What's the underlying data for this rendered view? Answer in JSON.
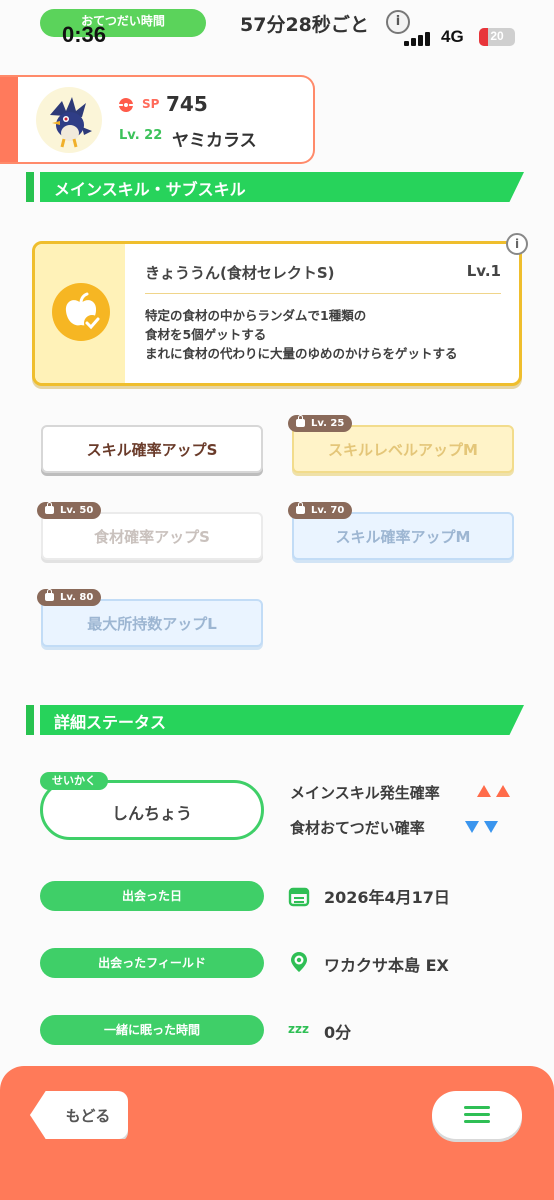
{
  "status_bar": {
    "help_label": "おてつだい時間",
    "time": "0:36",
    "interval": "57分28秒ごと",
    "network": "4G",
    "battery": "20"
  },
  "pokemon": {
    "sp_label": "SP",
    "sp_value": "745",
    "level": "Lv. 22",
    "name": "ヤミカラス"
  },
  "skills_section": {
    "title": "メインスキル・サブスキル",
    "main_skill": {
      "name": "きょううん(食材セレクトS)",
      "level": "Lv.1",
      "desc_line1": "特定の食材の中からランダムで1種類の",
      "desc_line2": "食材を5個ゲットする",
      "desc_line3": "まれに食材の代わりに大量のゆめのかけらをゲットする"
    },
    "subskills": [
      {
        "label": "スキル確率アップS",
        "lock": ""
      },
      {
        "label": "スキルレベルアップM",
        "lock": "Lv. 25"
      },
      {
        "label": "食材確率アップS",
        "lock": "Lv. 50"
      },
      {
        "label": "スキル確率アップM",
        "lock": "Lv. 70"
      },
      {
        "label": "最大所持数アップL",
        "lock": "Lv. 80"
      }
    ]
  },
  "detail_section": {
    "title": "詳細ステータス",
    "nature_tag": "せいかく",
    "nature": "しんちょう",
    "up_effect": "メインスキル発生確率",
    "down_effect": "食材おてつだい確率",
    "met_date_label": "出会った日",
    "met_date": "2026年4月17日",
    "met_field_label": "出会ったフィールド",
    "met_field": "ワカクサ本島 EX",
    "slept_label": "一緒に眠った時間",
    "slept_value": "0分",
    "sleep_icon_text": "zzz"
  },
  "footer": {
    "back_label": "もどる"
  },
  "colors": {
    "accent_green": "#27d35b",
    "accent_orange": "#ff7a59",
    "skill_gold": "#efbe2d"
  }
}
